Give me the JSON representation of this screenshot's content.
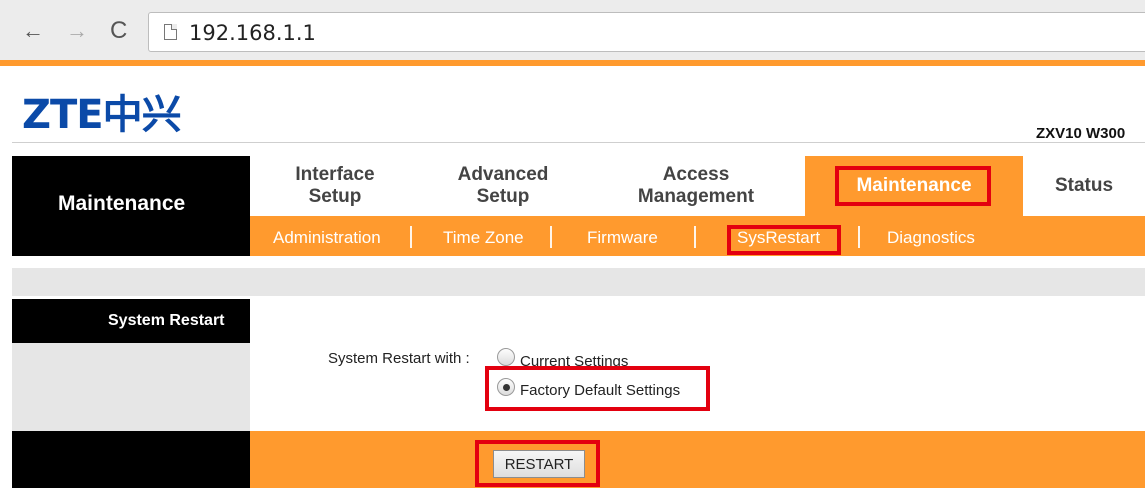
{
  "browser": {
    "back_icon": "←",
    "forward_icon": "→",
    "reload_icon": "C",
    "url": "192.168.1.1"
  },
  "header": {
    "logo": "ZTE中兴",
    "model": "ZXV10 W300"
  },
  "nav": {
    "section_title": "Maintenance",
    "tabs": [
      {
        "line1": "Interface",
        "line2": "Setup"
      },
      {
        "line1": "Advanced",
        "line2": "Setup"
      },
      {
        "line1": "Access",
        "line2": "Management"
      },
      {
        "line1": "Maintenance",
        "line2": ""
      },
      {
        "line1": "Status",
        "line2": ""
      }
    ],
    "active_tab_index": 3,
    "subtabs": [
      "Administration",
      "Time Zone",
      "Firmware",
      "SysRestart",
      "Diagnostics"
    ],
    "active_subtab_index": 3
  },
  "content": {
    "section_title": "System Restart",
    "field_label": "System Restart with :",
    "options": [
      {
        "label": "Current Settings",
        "checked": false
      },
      {
        "label": "Factory Default Settings",
        "checked": true
      }
    ],
    "restart_button": "RESTART"
  },
  "colors": {
    "accent_orange": "#ff9a2e",
    "highlight_red": "#e3000f",
    "logo_blue": "#0b4aa8"
  }
}
